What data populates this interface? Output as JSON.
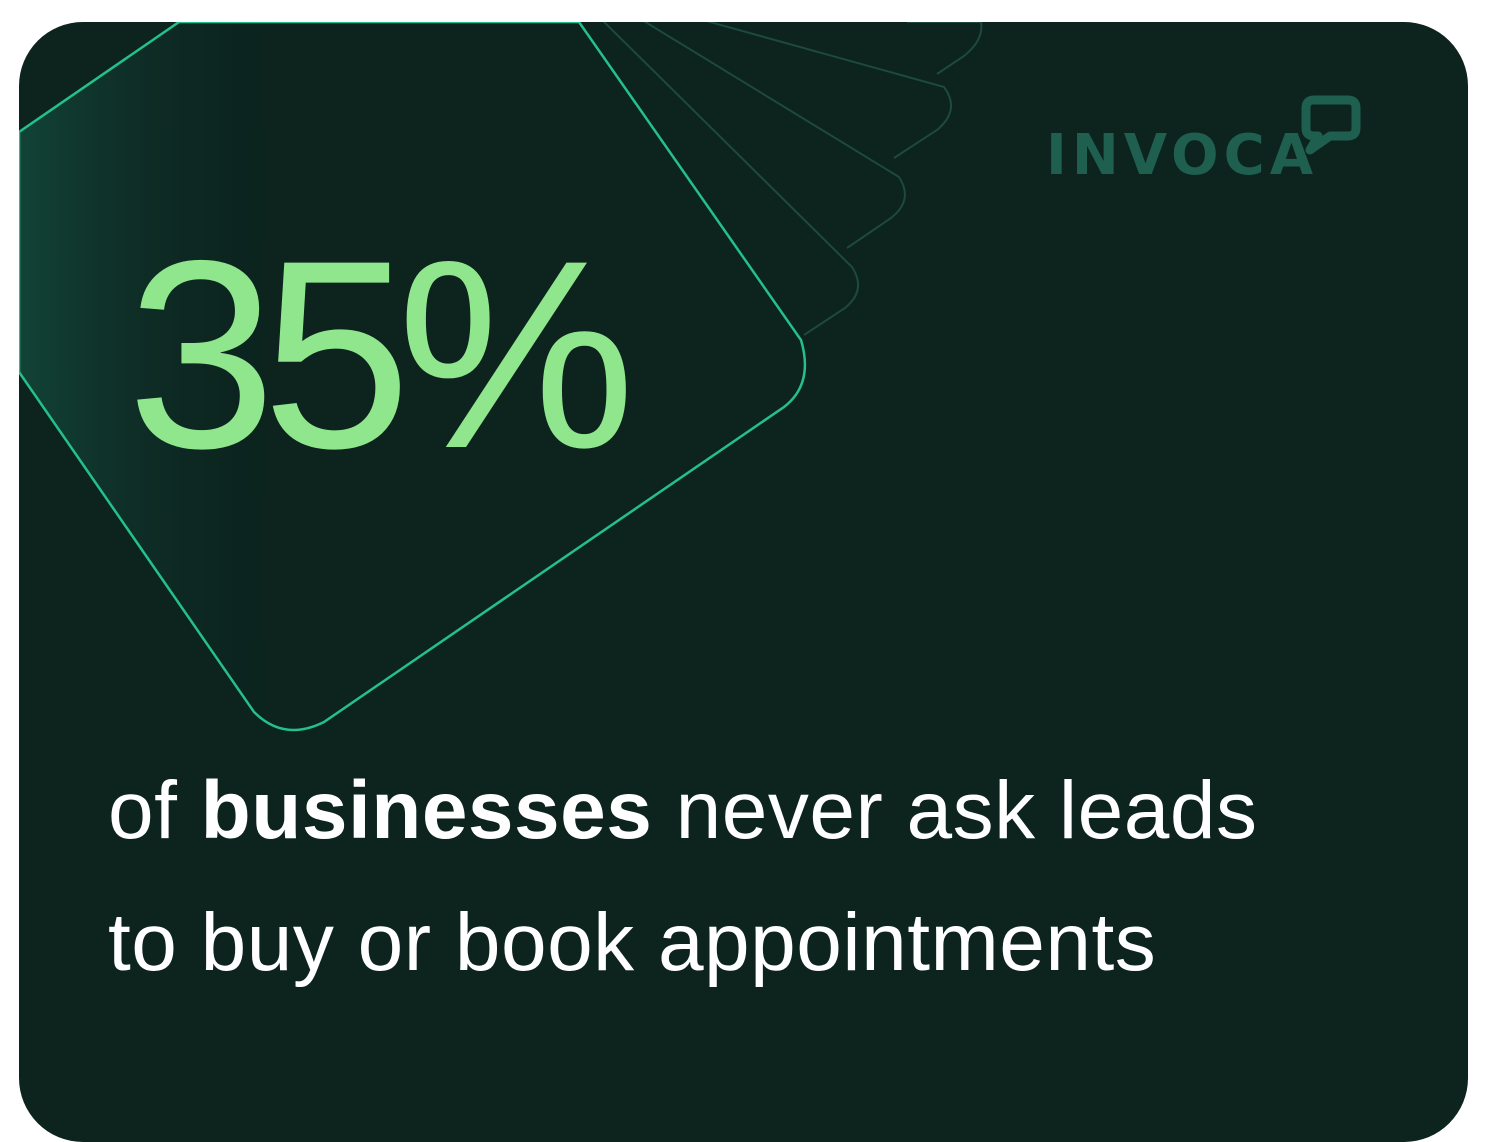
{
  "logo": {
    "text": "INVOCA",
    "icon": "chat-bubble-icon"
  },
  "stat": {
    "value": "35%"
  },
  "caption": {
    "lead": "of ",
    "emphasis": "businesses",
    "line1_rest": " never ask leads",
    "line2": "to buy or book appointments"
  },
  "colors": {
    "background": "#0c231e",
    "accent_green": "#8fe68d",
    "outline_green": "#25c08a",
    "logo_green": "#1f5f4f",
    "text": "#ffffff"
  }
}
